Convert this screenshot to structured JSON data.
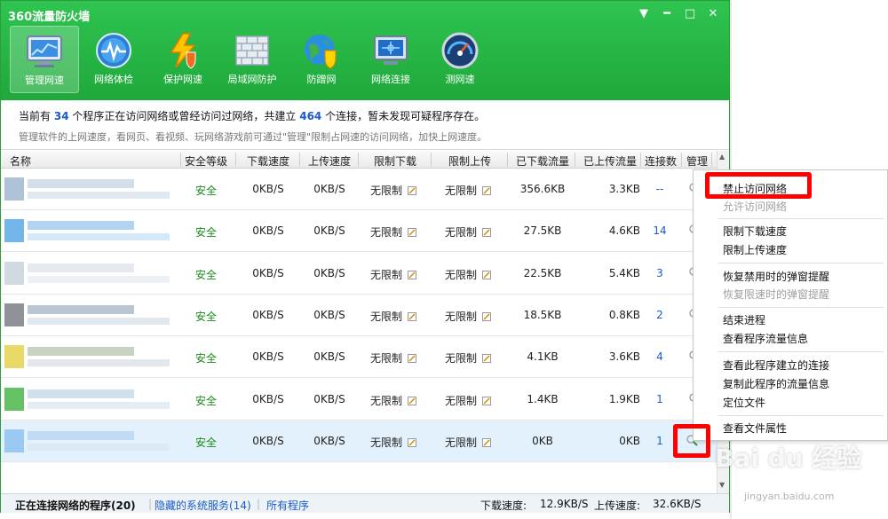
{
  "window": {
    "title": "360流量防火墙"
  },
  "toolbar": [
    {
      "label": "管理网速",
      "icon": "monitor-chart-icon",
      "active": true
    },
    {
      "label": "网络体检",
      "icon": "pulse-globe-icon",
      "active": false
    },
    {
      "label": "保护网速",
      "icon": "lightning-shield-icon",
      "active": false
    },
    {
      "label": "局域网防护",
      "icon": "brick-wall-icon",
      "active": false
    },
    {
      "label": "防蹭网",
      "icon": "globe-shield-icon",
      "active": false
    },
    {
      "label": "网络连接",
      "icon": "network-screen-icon",
      "active": false
    },
    {
      "label": "测网速",
      "icon": "speedometer-icon",
      "active": false
    }
  ],
  "info": {
    "prefix": "当前有",
    "program_count": "34",
    "mid": "个程序正在访问网络或曾经访问过网络，共建立",
    "connection_count": "464",
    "suffix": "个连接，暂未发现可疑程序存在。",
    "tip": "管理软件的上网速度，看网页、看视频、玩网络游戏前可通过\"管理\"限制占网速的访问网络，加快上网速度。"
  },
  "table": {
    "columns": [
      "名称",
      "安全等级",
      "下载速度",
      "上传速度",
      "限制下载",
      "限制上传",
      "已下载流量",
      "已上传流量",
      "连接数",
      "管理"
    ],
    "rows": [
      {
        "safety": "安全",
        "down": "0KB/S",
        "up": "0KB/S",
        "limit_down": "无限制",
        "limit_up": "无限制",
        "downloaded": "356.6KB",
        "uploaded": "3.3KB",
        "conns": "--"
      },
      {
        "safety": "安全",
        "down": "0KB/S",
        "up": "0KB/S",
        "limit_down": "无限制",
        "limit_up": "无限制",
        "downloaded": "27.5KB",
        "uploaded": "4.6KB",
        "conns": "14"
      },
      {
        "safety": "安全",
        "down": "0KB/S",
        "up": "0KB/S",
        "limit_down": "无限制",
        "limit_up": "无限制",
        "downloaded": "22.5KB",
        "uploaded": "5.4KB",
        "conns": "3"
      },
      {
        "safety": "安全",
        "down": "0KB/S",
        "up": "0KB/S",
        "limit_down": "无限制",
        "limit_up": "无限制",
        "downloaded": "18.5KB",
        "uploaded": "0.8KB",
        "conns": "2"
      },
      {
        "safety": "安全",
        "down": "0KB/S",
        "up": "0KB/S",
        "limit_down": "无限制",
        "limit_up": "无限制",
        "downloaded": "4.1KB",
        "uploaded": "3.6KB",
        "conns": "4"
      },
      {
        "safety": "安全",
        "down": "0KB/S",
        "up": "0KB/S",
        "limit_down": "无限制",
        "limit_up": "无限制",
        "downloaded": "1.4KB",
        "uploaded": "1.9KB",
        "conns": "1"
      },
      {
        "safety": "安全",
        "down": "0KB/S",
        "up": "0KB/S",
        "limit_down": "无限制",
        "limit_up": "无限制",
        "downloaded": "0KB",
        "uploaded": "0KB",
        "conns": "1"
      }
    ]
  },
  "status": {
    "tab_connected": "正在连接网络的程序(20)",
    "tab_hidden": "隐藏的系统服务(14)",
    "tab_all": "所有程序",
    "down_label": "下载速度:",
    "down_value": "12.9KB/S",
    "up_label": "上传速度:",
    "up_value": "32.6KB/S"
  },
  "context_menu": {
    "items": [
      {
        "label": "禁止访问网络",
        "disabled": false
      },
      {
        "label": "允许访问网络",
        "disabled": true
      },
      {
        "label": "限制下载速度",
        "disabled": false
      },
      {
        "label": "限制上传速度",
        "disabled": false
      },
      {
        "label": "恢复禁用时的弹窗提醒",
        "disabled": false
      },
      {
        "label": "恢复限速时的弹窗提醒",
        "disabled": true
      },
      {
        "label": "结束进程",
        "disabled": false
      },
      {
        "label": "查看程序流量信息",
        "disabled": false
      },
      {
        "label": "查看此程序建立的连接",
        "disabled": false
      },
      {
        "label": "复制此程序的流量信息",
        "disabled": false
      },
      {
        "label": "定位文件",
        "disabled": false
      },
      {
        "label": "查看文件属性",
        "disabled": false
      }
    ]
  },
  "watermark": {
    "text": "Bai du 经验",
    "url": "jingyan.baidu.com"
  },
  "colors": {
    "header_green": "#22b445",
    "safe_green": "#1a8a1a",
    "link_blue": "#1a5bc9",
    "highlight_red": "#ff0000"
  }
}
